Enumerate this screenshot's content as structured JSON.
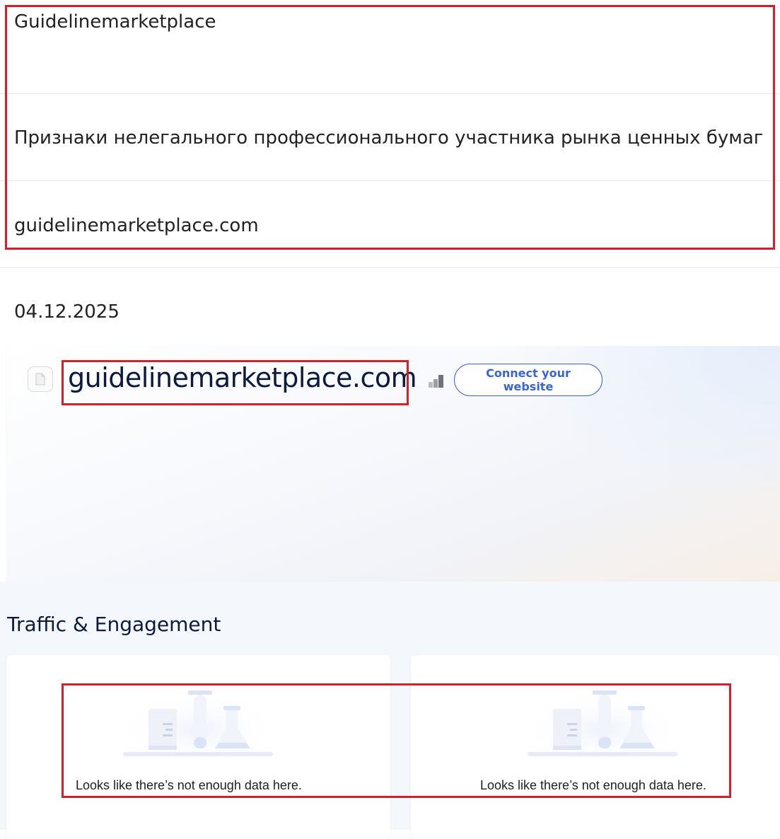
{
  "rows": {
    "title": "Guidelinemarketplace",
    "description": "Признаки нелегального профессионального участника рынка ценных бумаг",
    "domain": "guidelinemarketplace.com",
    "date": "04.12.2025"
  },
  "site_header": {
    "favicon": "document-icon",
    "domain": "guidelinemarketplace.com",
    "rank_icon": "bar-chart-icon",
    "connect_label_line1": "Connect your",
    "connect_label_line2": "website",
    "accent_color": "#3a63d6"
  },
  "traffic": {
    "section_title": "Traffic & Engagement",
    "cards": [
      {
        "empty_message": "Looks like there’s not enough data here.",
        "illustration": "lab-flasks-illustration"
      },
      {
        "empty_message": "Looks like there’s not enough data here.",
        "illustration": "lab-flasks-illustration"
      }
    ]
  },
  "highlight_color": "#d0212d"
}
